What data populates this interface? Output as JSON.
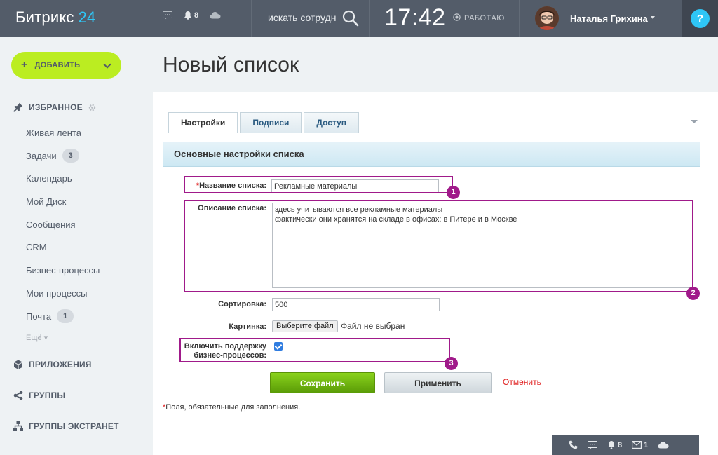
{
  "header": {
    "logo_text": "Битрикс",
    "logo_number": "24",
    "notifications_count": "8",
    "search_placeholder": "искать сотрудни",
    "time": "17:42",
    "work_status": "РАБОТАЮ",
    "user_name": "Наталья Грихина",
    "help_label": "?"
  },
  "sidebar": {
    "add_label": "ДОБАВИТЬ",
    "favorites_title": "ИЗБРАННОЕ",
    "items": [
      {
        "label": "Живая лента",
        "badge": ""
      },
      {
        "label": "Задачи",
        "badge": "3"
      },
      {
        "label": "Календарь",
        "badge": ""
      },
      {
        "label": "Мой Диск",
        "badge": ""
      },
      {
        "label": "Сообщения",
        "badge": ""
      },
      {
        "label": "CRM",
        "badge": ""
      },
      {
        "label": "Бизнес-процессы",
        "badge": ""
      },
      {
        "label": "Мои процессы",
        "badge": ""
      },
      {
        "label": "Почта",
        "badge": "1"
      }
    ],
    "more_label": "Ещё",
    "sections": [
      "ПРИЛОЖЕНИЯ",
      "ГРУППЫ",
      "ГРУППЫ ЭКСТРАНЕТ"
    ]
  },
  "main": {
    "title": "Новый список",
    "tabs": [
      "Настройки",
      "Подписи",
      "Доступ"
    ],
    "section_header": "Основные настройки списка",
    "form": {
      "name_required_mark": "*",
      "name_label": "Название списка:",
      "name_value": "Рекламные материалы",
      "description_label": "Описание списка:",
      "description_value": "здесь учитываются все рекламные материалы\nфактически они хранятся на складе в офисах: в Питере и в Москве",
      "sort_label": "Сортировка:",
      "sort_value": "500",
      "image_label": "Картинка:",
      "file_button": "Выберите файл",
      "file_none": "Файл не выбран",
      "bp_label_line1": "Включить поддержку",
      "bp_label_line2": "бизнес-процессов:",
      "bp_checked": true
    },
    "annotations": [
      "1",
      "2",
      "3"
    ],
    "buttons": {
      "save": "Сохранить",
      "apply": "Применить",
      "cancel": "Отменить"
    },
    "required_note_mark": "*",
    "required_note": "Поля, обязательные для заполнения."
  },
  "bottom_bar": {
    "notifications_count": "8",
    "mail_count": "1"
  },
  "colors": {
    "topbar": "#535c69",
    "accent_blue": "#2fc6f6",
    "add_button": "#bbed21",
    "annotation": "#a01a8a",
    "save_button": "#6fb810",
    "cancel_text": "#e02020"
  }
}
